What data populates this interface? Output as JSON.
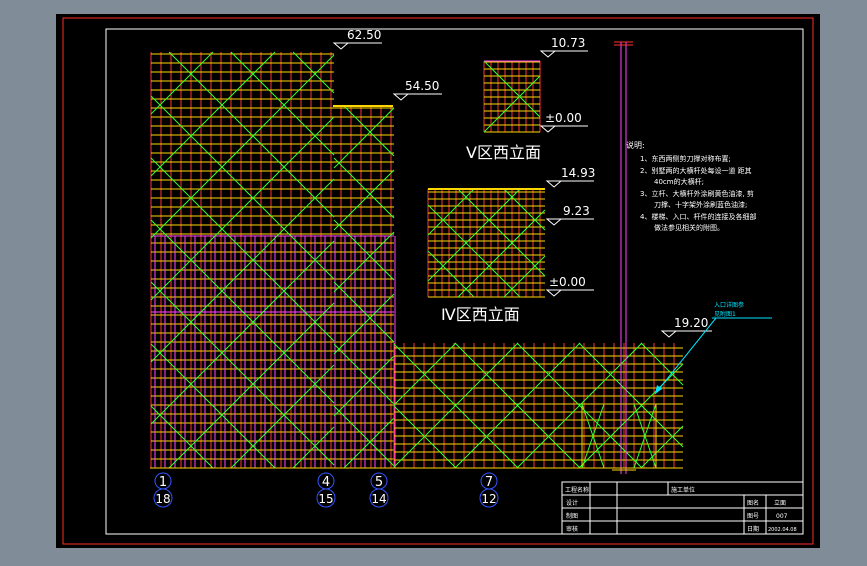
{
  "elevations": {
    "top": "62.50",
    "second": "54.50",
    "v_top": "10.73",
    "v_zero": "±0.00",
    "iv_top": "14.93",
    "iv_mid": "9.23",
    "iv_zero": "±0.00",
    "low": "19.20"
  },
  "section_labels": {
    "v": "Ⅴ区西立面",
    "iv": "Ⅳ区西立面"
  },
  "notes": {
    "heading": "说明:",
    "lines": [
      "1、东西两侧剪刀撑对称布置;",
      "2、别墅两的大横杆处每设一道 距其",
      "40cm的大横杆;",
      "3、立杆、大横杆外涂刷黄色油漆, 剪",
      "刀撑、十字架外涂刷蓝色油漆;",
      "4、楼梯、入口、杆件的连接及各细部",
      "做法参见相关的附图。"
    ]
  },
  "callout": {
    "line1": "入口详图参",
    "line2": "见附图1"
  },
  "axis_labels": {
    "top": [
      "1",
      "4",
      "5",
      "7"
    ],
    "bottom": [
      "18",
      "15",
      "14",
      "12"
    ]
  },
  "title_block": {
    "project_label": "工程名称",
    "build_label": "施工单位",
    "design_label": "设计",
    "draw_label": "制图",
    "check_label": "审核",
    "drawing_label": "图名",
    "drawing_value": "立面",
    "number_label": "图号",
    "number_value": "007",
    "date_label": "日期",
    "date_value": "2002.04.08"
  },
  "colors": {
    "background": "#000000",
    "frame": "#ff0000",
    "border": "#ffffff",
    "vertical_pole": "#ff3333",
    "ledger": "#ffd700",
    "brace": "#33ff33",
    "magenta_pole": "#ff44ff",
    "callout": "#00e5ff",
    "axis_circle": "#3355ff"
  }
}
